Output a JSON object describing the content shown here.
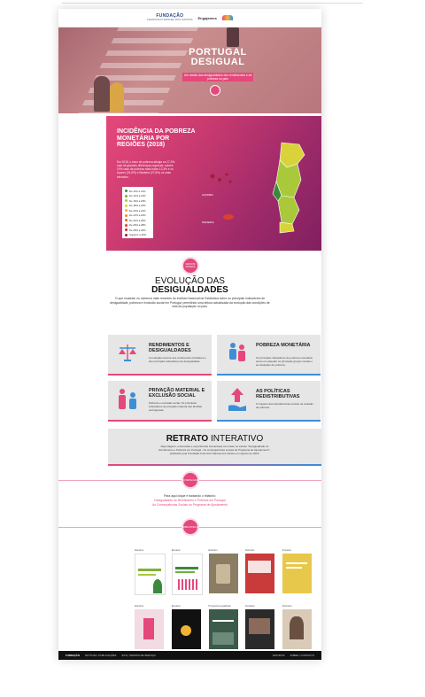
{
  "header": {
    "logo_main": "FUNDAÇÃO",
    "logo_sub": "FRANCISCO MANUEL DOS SANTOS",
    "partner": "Engajamos"
  },
  "hero": {
    "title_line1": "PORTUGAL",
    "title_line2": "DESIGUAL",
    "subtitle": "Um retrato das desigualdades dos rendimentos e da pobreza no país"
  },
  "map_section": {
    "title": "INCIDÊNCIA DA POBREZA MONETÁRIA POR REGIÕES (2018)",
    "text": "Em 2018, o risco de pobreza atingia os 17,3% mas há grandes diferenças regionais: sobres 10% caso da pobreza mais baixa 13,3% e os Açores (31,8%) e Madeira (27,8%) os mais elevados.",
    "azores_label": "AÇORES",
    "madeira_label": "MADEIRA",
    "legend": [
      {
        "label": "De 11% a 14%",
        "color": "#3b8a3b"
      },
      {
        "label": "De 14% a 16%",
        "color": "#6fb23a"
      },
      {
        "label": "De 16% a 18%",
        "color": "#a9c93a"
      },
      {
        "label": "De 18% a 20%",
        "color": "#d9d23a"
      },
      {
        "label": "De 20% a 22%",
        "color": "#f2b233"
      },
      {
        "label": "De 22% a 24%",
        "color": "#f08a2e"
      },
      {
        "label": "De 24% a 26%",
        "color": "#e8622c"
      },
      {
        "label": "De 26% a 28%",
        "color": "#d9432e"
      },
      {
        "label": "De 28% a 30%",
        "color": "#c22f3a"
      },
      {
        "label": "Superior a 30%",
        "color": "#a01f3a"
      }
    ]
  },
  "novos_dados": "NOVOS DADOS",
  "evolucao": {
    "title_a": "EVOLUÇÃO DAS",
    "title_b": "DESIGUALDADES",
    "text": "O que mostram os números mais recentes do Instituto Nacional de Estatística sobre os principais indicadores de desigualdade, pobreza e exclusão social em Portugal: permitindo uma leitura actualizada da evolução das condições de vida da população no país."
  },
  "cards": [
    {
      "title": "RENDIMENTOS E DESIGUALDADES",
      "desc": "A evolução recente dos rendimentos familiares e dos principais indicadores de desigualdade.",
      "color": "#e5487b"
    },
    {
      "title": "POBREZA MONETÁRIA",
      "desc": "Os principais indicadores de pobreza monetária, tendo em atenção os principais grupos sociais e as situações de pobreza.",
      "color": "#3d8ed6"
    },
    {
      "title": "PRIVAÇÃO MATERIAL E EXCLUSÃO SOCIAL",
      "desc": "Pobreza e exclusão social. Os principais indicadores de privação material das famílias portuguesas.",
      "color": "#e5487b"
    },
    {
      "title": "AS POLÍTICAS REDISTRIBUTIVAS",
      "desc": "O impacto das transferências sociais na redução da pobreza.",
      "color": "#3d8ed6"
    }
  ],
  "retrato": {
    "title_bold": "RETRATO",
    "title_rest": " INTERATIVO",
    "text": "Reportagens, entrevistas e experiências interactivas com base no estudo \"Desigualdade do Rendimento e Pobreza em Portugal - As consequências sociais do Programa de Ajustamento\", publicado pela Fundação Francisco Manuel dos Santos em Agosto de 2016."
  },
  "download": {
    "icon_label": "DOWNLOAD",
    "line1": "Para aqui clique e baixando o relatório:",
    "link1": "Desigualdade do Rendimento e Pobreza em Portugal",
    "link2": "As Consequências Sociais do Programa de Ajustamento"
  },
  "biblioteca": {
    "icon_label": "BIBLIOTECA"
  },
  "books_row1": [
    {
      "category": "Estudos"
    },
    {
      "category": "Ensaios"
    },
    {
      "category": "Estudos"
    },
    {
      "category": "Estudos"
    },
    {
      "category": "Ensaios"
    }
  ],
  "books_row2": [
    {
      "category": "Estudos"
    },
    {
      "category": "Ensaios"
    },
    {
      "category": "Programa Igualdade"
    },
    {
      "category": "Debates"
    },
    {
      "category": "Retratos"
    }
  ],
  "footer": {
    "left1": "FUNDAÇÃO",
    "left2": "NOTÍCIAS | PUBLICAÇÕES",
    "left3": "SITE | TERMOS DE SERVIÇO",
    "right1": "ESTUDOS",
    "right2": "SOBRE | CONTACTO"
  }
}
